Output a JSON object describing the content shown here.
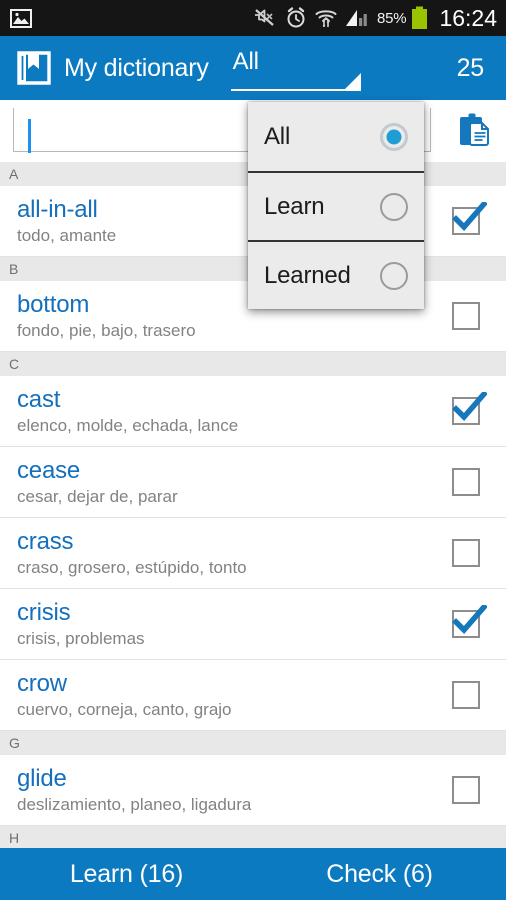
{
  "status_bar": {
    "left_icon": "image-icon",
    "icons": [
      "mute-icon",
      "alarm-icon",
      "wifi-transfer-icon",
      "signal-icon"
    ],
    "battery_percent": "85%",
    "battery_icon": "battery-icon",
    "clock": "16:24",
    "background": "#151515"
  },
  "action_bar": {
    "app_icon": "book-bookmark-icon",
    "title": "My dictionary",
    "filter_value": "All",
    "dropdown_caret": "caret-down-icon",
    "count": "25",
    "background": "#0c7ac0"
  },
  "search": {
    "value": "",
    "placeholder": "",
    "clipboard_icon": "clipboard-icon"
  },
  "dropdown": {
    "open": true,
    "options": [
      {
        "label": "All",
        "selected": true
      },
      {
        "label": "Learn",
        "selected": false
      },
      {
        "label": "Learned",
        "selected": false
      }
    ]
  },
  "list": {
    "sections": [
      {
        "letter": "A",
        "entries": [
          {
            "word": "all-in-all",
            "translations": "todo, amante",
            "checked": true
          }
        ]
      },
      {
        "letter": "B",
        "entries": [
          {
            "word": "bottom",
            "translations": "fondo, pie, bajo, trasero",
            "checked": false
          }
        ]
      },
      {
        "letter": "C",
        "entries": [
          {
            "word": "cast",
            "translations": "elenco, molde, echada, lance",
            "checked": true
          },
          {
            "word": "cease",
            "translations": "cesar, dejar de, parar",
            "checked": false
          },
          {
            "word": "crass",
            "translations": "craso, grosero, estúpido, tonto",
            "checked": false
          },
          {
            "word": "crisis",
            "translations": "crisis, problemas",
            "checked": true
          },
          {
            "word": "crow",
            "translations": "cuervo, corneja, canto, grajo",
            "checked": false
          }
        ]
      },
      {
        "letter": "G",
        "entries": [
          {
            "word": "glide",
            "translations": "deslizamiento, planeo, ligadura",
            "checked": false
          }
        ]
      },
      {
        "letter": "H",
        "entries": []
      }
    ]
  },
  "bottom_bar": {
    "learn_label": "Learn (16)",
    "check_label": "Check (6)",
    "background": "#0c7ac0"
  },
  "colors": {
    "accent": "#0c7ac0",
    "word_blue": "#1470bd",
    "translation_gray": "#828282",
    "section_bg": "#e8e8e8"
  }
}
